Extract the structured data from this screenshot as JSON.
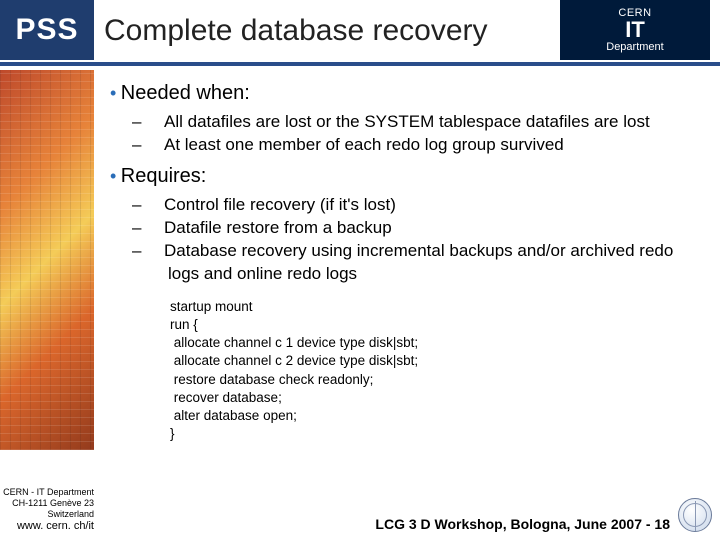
{
  "header": {
    "badge": "PSS",
    "title": "Complete database recovery",
    "logo": {
      "line1": "CERN",
      "line2": "IT",
      "line3": "Department"
    }
  },
  "bullets": {
    "b1": {
      "label": "Needed when:",
      "sub": [
        "All datafiles are lost or the SYSTEM tablespace datafiles are lost",
        "At least one member of each redo log group survived"
      ]
    },
    "b2": {
      "label": "Requires:",
      "sub": [
        "Control file recovery (if it's lost)",
        "Datafile restore from a backup",
        "Database recovery using incremental backups and/or archived redo logs and online redo logs"
      ]
    }
  },
  "code": "startup mount\nrun {\n allocate channel c 1 device type disk|sbt;\n allocate channel c 2 device type disk|sbt;\n restore database check readonly;\n recover database;\n alter database open;\n}",
  "footer": {
    "line1": "CERN - IT Department",
    "line2": "CH-1211 Genève 23",
    "line3": "Switzerland",
    "url": "www. cern. ch/it"
  },
  "event": "LCG 3 D Workshop, Bologna, June 2007 - 18"
}
